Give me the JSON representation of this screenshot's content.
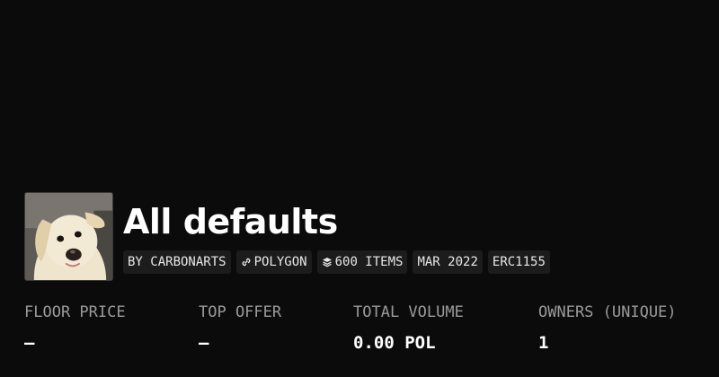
{
  "collection": {
    "name": "All defaults",
    "badges": [
      {
        "label": "BY CARBONARTS",
        "icon": ""
      },
      {
        "label": "POLYGON",
        "icon": "link-icon"
      },
      {
        "label": "600 ITEMS",
        "icon": "layers-icon"
      },
      {
        "label": "MAR 2022",
        "icon": ""
      },
      {
        "label": "ERC1155",
        "icon": ""
      }
    ]
  },
  "stats": [
    {
      "label": "FLOOR PRICE",
      "value": "—"
    },
    {
      "label": "TOP OFFER",
      "value": "—"
    },
    {
      "label": "TOTAL VOLUME",
      "value": "0.00 POL"
    },
    {
      "label": "OWNERS (UNIQUE)",
      "value": "1"
    }
  ],
  "colors": {
    "background": "#0b0b0b",
    "badge_background": "#1c1c1c",
    "label_text": "#9b9b9b"
  }
}
